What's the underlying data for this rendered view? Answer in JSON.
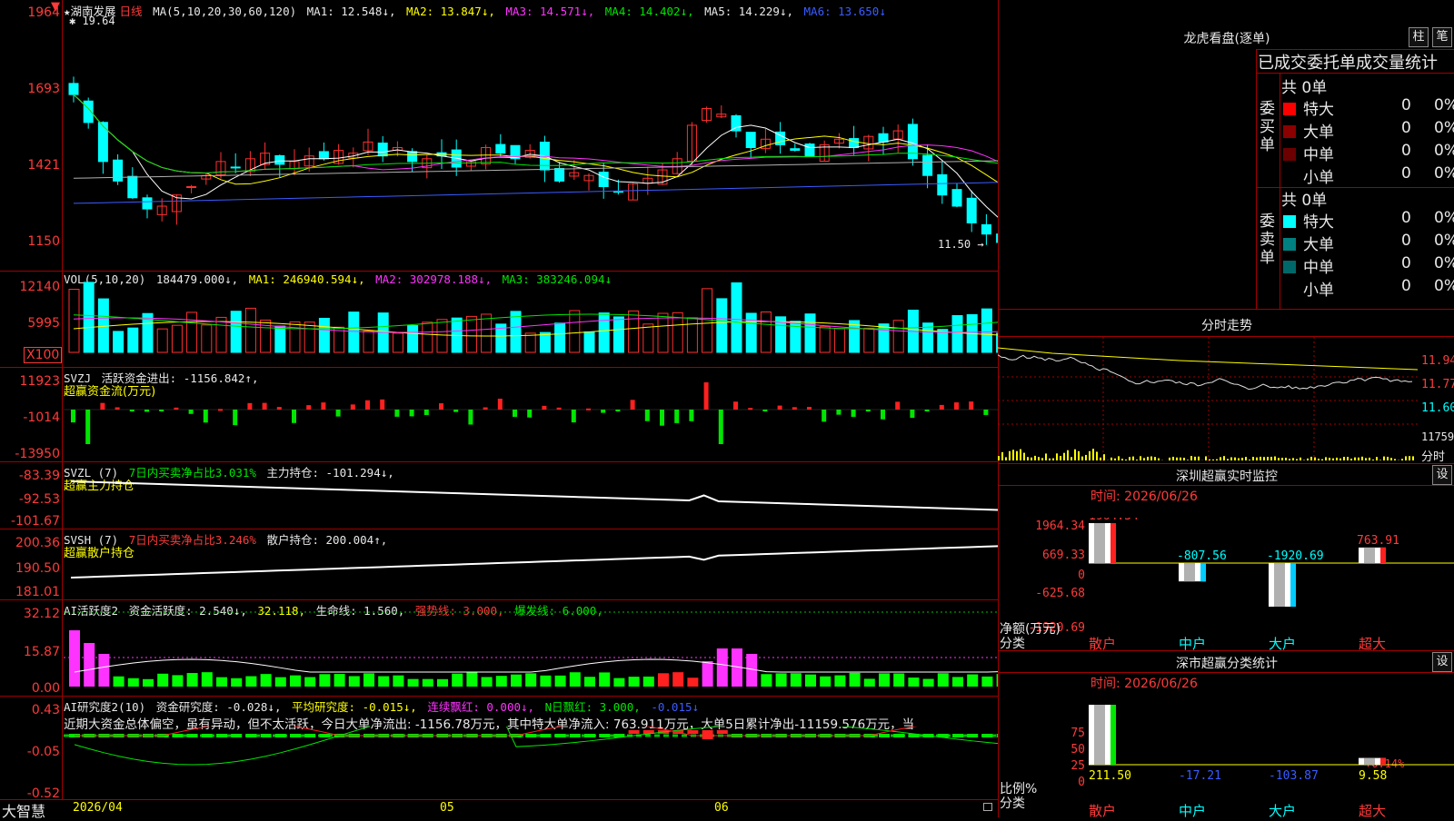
{
  "header": {
    "star_name": "★湖南发展",
    "period": "日线",
    "ma_label": "MA(5,10,20,30,60,120)",
    "ma1": "MA1: 12.548↓,",
    "ma2": "MA2: 13.847↓,",
    "ma3": "MA3: 14.571↓,",
    "ma4": "MA4: 14.402↓,",
    "ma5": "MA5: 14.229↓,",
    "ma6": "MA6: 13.650↓",
    "high_marker": "19.64",
    "low_marker": "11.50"
  },
  "price_axis": [
    "1964",
    "1693",
    "1421",
    "1150"
  ],
  "vol": {
    "label": "VOL(5,10,20)",
    "val": "184479.000↓,",
    "ma1": "MA1: 246940.594↓,",
    "ma2": "MA2: 302978.188↓,",
    "ma3": "MA3: 383246.094↓",
    "axis": [
      "12140",
      "5995"
    ],
    "unit": "X100"
  },
  "svzj": {
    "label": "SVZJ",
    "text": "活跃资金进出: -1156.842↑,",
    "sub": "超赢资金流(万元)",
    "axis": [
      "11923",
      "-1014",
      "-13950"
    ]
  },
  "svzl": {
    "label": "SVZL (7)",
    "text1": "7日内买卖净占比3.031%",
    "text2": "主力持仓: -101.294↓,",
    "sub": "超赢主力持仓",
    "axis": [
      "-83.39",
      "-92.53",
      "-101.67"
    ]
  },
  "svsh": {
    "label": "SVSH (7)",
    "text1": "7日内买卖净占比3.246%",
    "text2": "散户持仓: 200.004↑,",
    "sub": "超赢散户持仓",
    "axis": [
      "200.36",
      "190.50",
      "181.01"
    ]
  },
  "ai1": {
    "label": "AI活跃度2",
    "t1": "资金活跃度: 2.540↓,",
    "t2": "32.118,",
    "t3": "生命线: 1.560,",
    "t4": "强势线: 3.000,",
    "t5": "爆发线: 6.000,",
    "axis": [
      "32.12",
      "15.87",
      "0.00"
    ]
  },
  "ai2": {
    "label": "AI研究度2(10)",
    "t1": "资金研究度: -0.028↓,",
    "t2": "平均研究度: -0.015↓,",
    "t3": "连续飘红: 0.000↓,",
    "t4": "N日飘红: 3.000,",
    "t5": "-0.015↓",
    "desc": "近期大资金总体偏空，虽有异动，但不太活跃，今日大单净流出: -1156.78万元，其中特大单净流入: 763.911万元，大单5日累计净出-11159.576万元，当",
    "axis": [
      "0.43",
      "-0.05",
      "-0.52"
    ]
  },
  "bottom": {
    "brand": "大智慧",
    "date_label": "2026/04",
    "month1": "05",
    "month2": "06"
  },
  "lhb": {
    "title": "龙虎看盘(逐单)",
    "btn1": "柱",
    "btn2": "笔",
    "header": "已成交委托单成交量统计",
    "buy_group": "委买单",
    "sell_group": "委卖单",
    "buy_total": "共 0单",
    "sell_total": "共 0单",
    "buy_rows": [
      {
        "name": "特大",
        "count": "0",
        "pct": "0%",
        "color": "#ff0000"
      },
      {
        "name": "大单",
        "count": "0",
        "pct": "0%",
        "color": "#8b0000"
      },
      {
        "name": "中单",
        "count": "0",
        "pct": "0%",
        "color": "#6b0000"
      },
      {
        "name": "小单",
        "count": "0",
        "pct": "0%",
        "color": ""
      }
    ],
    "sell_rows": [
      {
        "name": "特大",
        "count": "0",
        "pct": "0%",
        "color": "#00ffff"
      },
      {
        "name": "大单",
        "count": "0",
        "pct": "0%",
        "color": "#008080"
      },
      {
        "name": "中单",
        "count": "0",
        "pct": "0%",
        "color": "#006868"
      },
      {
        "name": "小单",
        "count": "0",
        "pct": "0%",
        "color": ""
      }
    ]
  },
  "intraday": {
    "title": "分时走势",
    "p1": "11.94",
    "p2": "11.77",
    "p3": "11.60",
    "vol": "11759",
    "unit": "分时"
  },
  "monitor": {
    "title": "深圳超赢实时监控",
    "btn": "设",
    "time": "时间: 2026/06/26",
    "axis": [
      "1964.34",
      "669.33",
      "0",
      "-625.68",
      "-1920.69"
    ],
    "ylabel1": "净额(万元)",
    "ylabel2": "分类",
    "bars": [
      {
        "name": "散户",
        "value": 1964.34,
        "label": "1964.34"
      },
      {
        "name": "中户",
        "value": -807.56,
        "label": "-807.56"
      },
      {
        "name": "大户",
        "value": -1920.69,
        "label": "-1920.69"
      },
      {
        "name": "超大",
        "value": 763.91,
        "label": "763.91"
      }
    ]
  },
  "classify": {
    "title": "深市超赢分类统计",
    "btn": "设",
    "time": "时间: 2026/06/26",
    "axis": [
      "75",
      "50",
      "25",
      "0"
    ],
    "ylabel1": "比例%",
    "ylabel2": "分类",
    "pct_label": "+0.14%",
    "bars": [
      {
        "name": "散户",
        "value": 211.5,
        "label": "211.50"
      },
      {
        "name": "中户",
        "value": -17.21,
        "label": "-17.21"
      },
      {
        "name": "大户",
        "value": -103.87,
        "label": "-103.87"
      },
      {
        "name": "超大",
        "value": 9.58,
        "label": "9.58"
      }
    ]
  },
  "chart_data": [
    {
      "type": "line",
      "title": "湖南发展 日线",
      "ylim": [
        11.5,
        19.64
      ],
      "yticks": [
        "1964",
        "1693",
        "1421",
        "1150"
      ],
      "series": [
        {
          "name": "MA1",
          "values": [
            12.548
          ]
        },
        {
          "name": "MA2",
          "values": [
            13.847
          ]
        },
        {
          "name": "MA3",
          "values": [
            14.571
          ]
        },
        {
          "name": "MA4",
          "values": [
            14.402
          ]
        },
        {
          "name": "MA5",
          "values": [
            14.229
          ]
        },
        {
          "name": "MA6",
          "values": [
            13.65
          ]
        }
      ]
    },
    {
      "type": "bar",
      "title": "深圳超赢实时监控",
      "categories": [
        "散户",
        "中户",
        "大户",
        "超大"
      ],
      "values": [
        1964.34,
        -807.56,
        -1920.69,
        763.91
      ],
      "ylim": [
        -1920.69,
        1964.34
      ]
    },
    {
      "type": "bar",
      "title": "深市超赢分类统计",
      "categories": [
        "散户",
        "中户",
        "大户",
        "超大"
      ],
      "values": [
        211.5,
        -17.21,
        -103.87,
        9.58
      ],
      "ylim": [
        0,
        75
      ]
    }
  ]
}
